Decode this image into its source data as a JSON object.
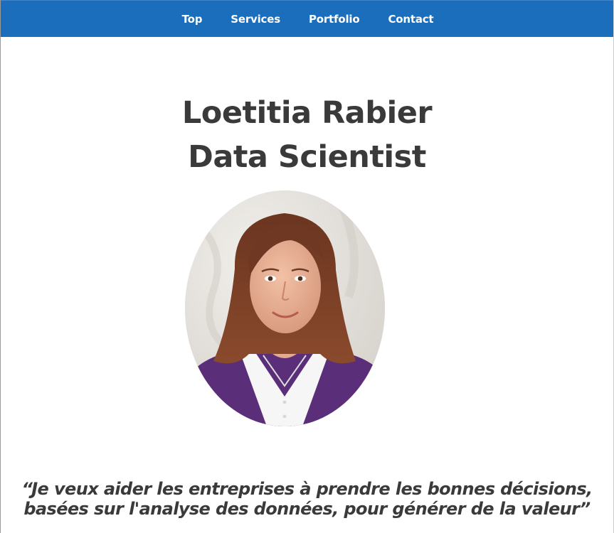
{
  "nav": {
    "links": [
      {
        "label": "Top"
      },
      {
        "label": "Services"
      },
      {
        "label": "Portfolio"
      },
      {
        "label": "Contact"
      }
    ],
    "background_color": "#1a6ebb"
  },
  "hero": {
    "name": "Loetitia Rabier",
    "role": "Data Scientist",
    "photo": "portrait-photo"
  },
  "quote": {
    "line1": "“Je veux aider les entreprises à prendre les bonnes décisions,",
    "line2": "basées sur l'analyse des données, pour générer de la valeur”"
  }
}
